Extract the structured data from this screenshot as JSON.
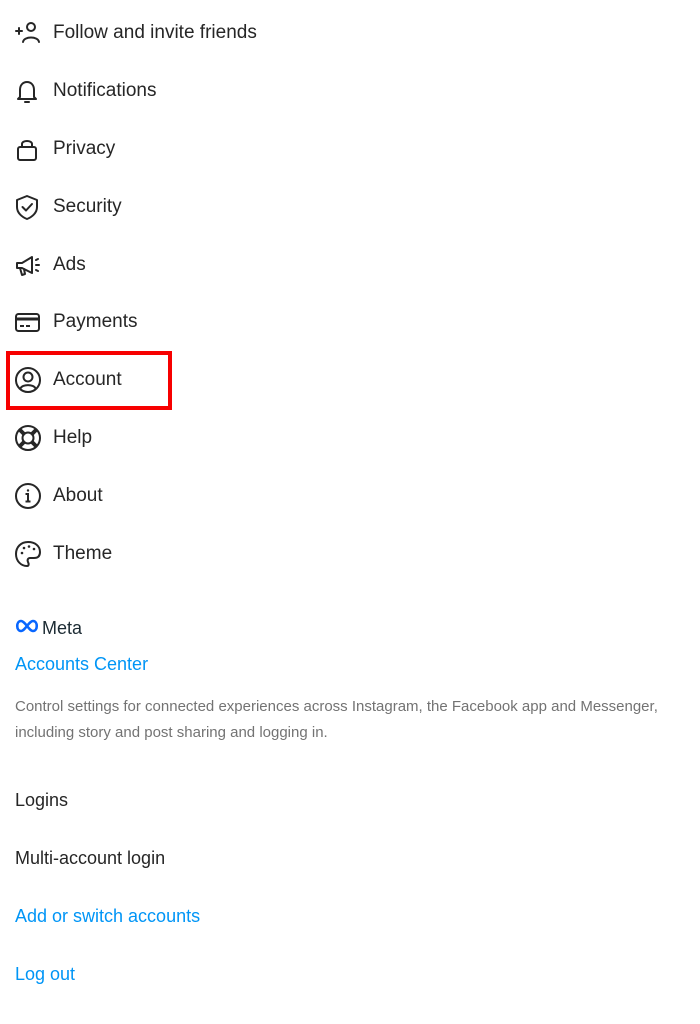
{
  "menu": {
    "items": [
      {
        "label": "Follow and invite friends",
        "icon": "add-person-icon"
      },
      {
        "label": "Notifications",
        "icon": "bell-icon"
      },
      {
        "label": "Privacy",
        "icon": "lock-icon"
      },
      {
        "label": "Security",
        "icon": "shield-check-icon"
      },
      {
        "label": "Ads",
        "icon": "megaphone-icon"
      },
      {
        "label": "Payments",
        "icon": "credit-card-icon"
      },
      {
        "label": "Account",
        "icon": "user-circle-icon"
      },
      {
        "label": "Help",
        "icon": "lifebuoy-icon"
      },
      {
        "label": "About",
        "icon": "info-icon"
      },
      {
        "label": "Theme",
        "icon": "palette-icon"
      }
    ],
    "highlighted_item": "Account",
    "highlight_color": "#f70000"
  },
  "meta_section": {
    "brand": "Meta",
    "accounts_center_label": "Accounts Center",
    "description": "Control settings for connected experiences across Instagram, the Facebook app and Messenger, including story and post sharing and logging in.",
    "link_color": "#0095f6"
  },
  "logins": {
    "heading": "Logins",
    "multi_account_label": "Multi-account login",
    "add_switch_label": "Add or switch accounts",
    "logout_label": "Log out"
  }
}
